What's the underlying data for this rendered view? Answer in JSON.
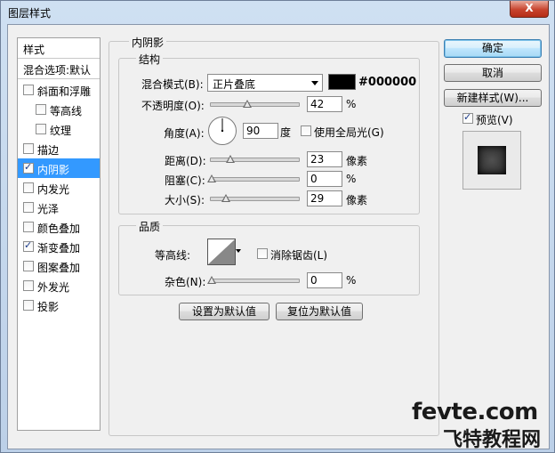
{
  "window": {
    "title": "图层样式",
    "close_label": "X"
  },
  "style_list": {
    "header": "样式",
    "blend_options": "混合选项:默认",
    "items": [
      {
        "label": "斜面和浮雕",
        "checked": false,
        "indent": false,
        "selected": false
      },
      {
        "label": "等高线",
        "checked": false,
        "indent": true,
        "selected": false
      },
      {
        "label": "纹理",
        "checked": false,
        "indent": true,
        "selected": false
      },
      {
        "label": "描边",
        "checked": false,
        "indent": false,
        "selected": false
      },
      {
        "label": "内阴影",
        "checked": true,
        "indent": false,
        "selected": true
      },
      {
        "label": "内发光",
        "checked": false,
        "indent": false,
        "selected": false
      },
      {
        "label": "光泽",
        "checked": false,
        "indent": false,
        "selected": false
      },
      {
        "label": "颜色叠加",
        "checked": false,
        "indent": false,
        "selected": false
      },
      {
        "label": "渐变叠加",
        "checked": true,
        "indent": false,
        "selected": false
      },
      {
        "label": "图案叠加",
        "checked": false,
        "indent": false,
        "selected": false
      },
      {
        "label": "外发光",
        "checked": false,
        "indent": false,
        "selected": false
      },
      {
        "label": "投影",
        "checked": false,
        "indent": false,
        "selected": false
      }
    ]
  },
  "panel": {
    "title": "内阴影",
    "structure": {
      "title": "结构",
      "blend_mode_label": "混合模式(B):",
      "blend_mode_value": "正片叠底",
      "color_hex": "#000000",
      "color_swatch": "#000000",
      "opacity_label": "不透明度(O):",
      "opacity_value": "42",
      "opacity_unit": "%",
      "opacity_fraction": 0.42,
      "angle_label": "角度(A):",
      "angle_value": "90",
      "angle_unit": "度",
      "global_light_label": "使用全局光(G)",
      "global_light_checked": false,
      "distance_label": "距离(D):",
      "distance_value": "23",
      "distance_unit": "像素",
      "choke_label": "阻塞(C):",
      "choke_value": "0",
      "choke_unit": "%",
      "size_label": "大小(S):",
      "size_value": "29",
      "size_unit": "像素"
    },
    "quality": {
      "title": "品质",
      "contour_label": "等高线:",
      "anti_alias_label": "消除锯齿(L)",
      "anti_alias_checked": false,
      "noise_label": "杂色(N):",
      "noise_value": "0",
      "noise_unit": "%"
    },
    "set_default": "设置为默认值",
    "reset_default": "复位为默认值"
  },
  "buttons": {
    "ok": "确定",
    "cancel": "取消",
    "new_style": "新建样式(W)...",
    "preview_label": "预览(V)",
    "preview_checked": true
  },
  "watermark": {
    "line1": "fevte.com",
    "line2": "飞特教程网"
  }
}
